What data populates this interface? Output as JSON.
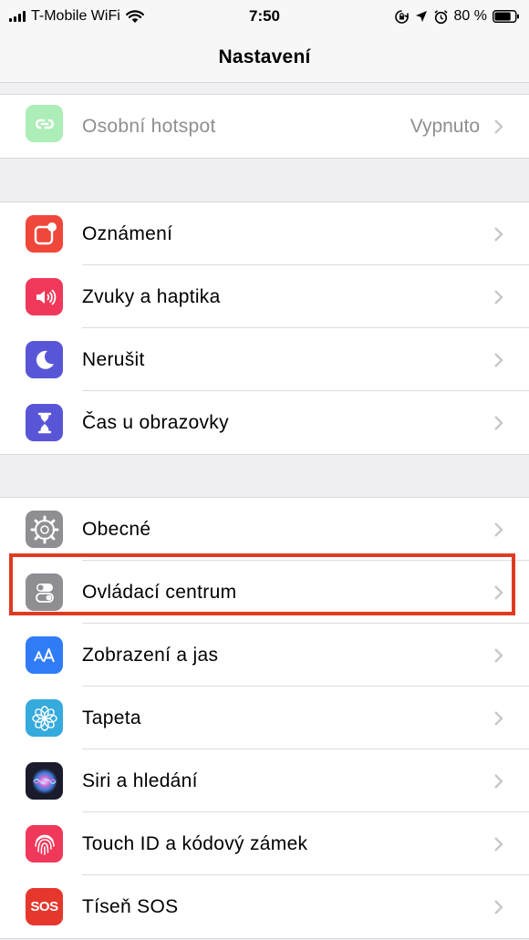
{
  "status_bar": {
    "carrier": "T-Mobile WiFi",
    "time": "7:50",
    "battery": "80 %",
    "battery_level": 0.8
  },
  "nav": {
    "title": "Nastavení"
  },
  "groups": [
    {
      "id": "network",
      "rows": [
        {
          "label": "Osobní hotspot",
          "value": "Vypnuto",
          "icon": "hotspot-icon",
          "color": "#4cd964",
          "disabled": true
        }
      ]
    },
    {
      "id": "notifications",
      "rows": [
        {
          "label": "Oznámení",
          "icon": "notifications-icon",
          "color": "#f0473b"
        },
        {
          "label": "Zvuky a haptika",
          "icon": "speaker-icon",
          "color": "#f0385a"
        },
        {
          "label": "Nerušit",
          "icon": "moon-icon",
          "color": "#5856d6"
        },
        {
          "label": "Čas u obrazovky",
          "icon": "hourglass-icon",
          "color": "#5856d6"
        }
      ]
    },
    {
      "id": "general",
      "rows": [
        {
          "label": "Obecné",
          "icon": "gear-icon",
          "color": "#8e8e93"
        },
        {
          "label": "Ovládací centrum",
          "icon": "toggles-icon",
          "color": "#8e8e93",
          "highlighted": true
        },
        {
          "label": "Zobrazení a jas",
          "icon": "text-size-icon",
          "color": "#2f7cf6"
        },
        {
          "label": "Tapeta",
          "icon": "flower-icon",
          "color": "#35aadc"
        },
        {
          "label": "Siri a hledání",
          "icon": "siri-icon",
          "color": "#1b1b2e"
        },
        {
          "label": "Touch ID a kódový zámek",
          "icon": "fingerprint-icon",
          "color": "#f0385a"
        },
        {
          "label": "Tíseň SOS",
          "icon": "sos-icon",
          "color": "#e6372c",
          "icon_text": "SOS"
        }
      ]
    }
  ],
  "colors": {
    "highlight": "#e03a21",
    "background": "#efeff4"
  }
}
